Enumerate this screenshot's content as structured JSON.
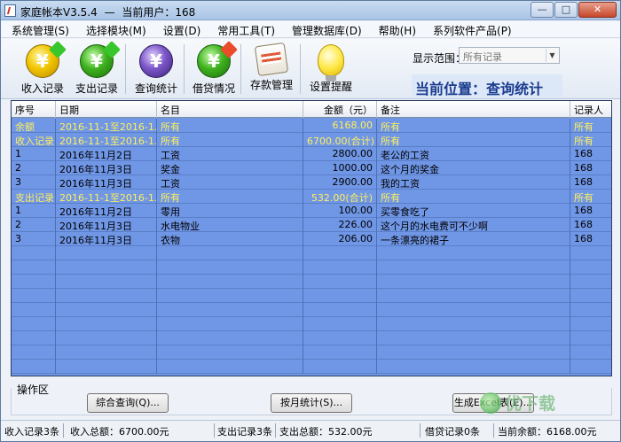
{
  "window": {
    "title": "家庭帐本V3.5.4",
    "separator": "—",
    "current_user": "当前用户：168",
    "minimize": "—",
    "maximize": "□",
    "close": "✕"
  },
  "menu": [
    "系统管理(S)",
    "选择模块(M)",
    "设置(D)",
    "常用工具(T)",
    "管理数据库(D)",
    "帮助(H)",
    "系列软件产品(P)"
  ],
  "toolbar": {
    "tools": [
      {
        "label": "收入记录",
        "icon": "income-coin-icon"
      },
      {
        "label": "支出记录",
        "icon": "expense-coin-icon"
      },
      {
        "label": "查询统计",
        "icon": "query-magnifier-icon"
      },
      {
        "label": "借贷情况",
        "icon": "loan-coin-icon"
      },
      {
        "label": "存款管理",
        "icon": "deposit-book-icon"
      },
      {
        "label": "设置提醒",
        "icon": "lightbulb-icon"
      }
    ],
    "range_label": "显示范围：",
    "range_value": "所有记录",
    "location": "当前位置：查询统计"
  },
  "table": {
    "columns": [
      "序号",
      "日期",
      "名目",
      "金额（元）",
      "备注",
      "记录人"
    ],
    "rows": [
      {
        "type": "summary",
        "cells": [
          "余额",
          "2016-11-1至2016-1...",
          "所有",
          "6168.00",
          "所有",
          "所有"
        ]
      },
      {
        "type": "summary",
        "cells": [
          "收入记录",
          "2016-11-1至2016-1...",
          "所有",
          "6700.00(合计)",
          "所有",
          "所有"
        ]
      },
      {
        "type": "detail",
        "cells": [
          "1",
          "2016年11月2日",
          "工资",
          "2800.00",
          "老公的工资",
          "168"
        ]
      },
      {
        "type": "detail",
        "cells": [
          "2",
          "2016年11月3日",
          "奖金",
          "1000.00",
          "这个月的奖金",
          "168"
        ]
      },
      {
        "type": "detail",
        "cells": [
          "3",
          "2016年11月3日",
          "工资",
          "2900.00",
          "我的工资",
          "168"
        ]
      },
      {
        "type": "summary",
        "cells": [
          "支出记录",
          "2016-11-1至2016-1...",
          "所有",
          "532.00(合计)",
          "所有",
          "所有"
        ]
      },
      {
        "type": "detail",
        "cells": [
          "1",
          "2016年11月2日",
          "零用",
          "100.00",
          "买零食吃了",
          "168"
        ]
      },
      {
        "type": "detail",
        "cells": [
          "2",
          "2016年11月3日",
          "水电物业",
          "226.00",
          "这个月的水电费可不少啊",
          "168"
        ]
      },
      {
        "type": "detail",
        "cells": [
          "3",
          "2016年11月3日",
          "衣物",
          "206.00",
          "一条漂亮的裙子",
          "168"
        ]
      }
    ]
  },
  "ops": {
    "label": "操作区",
    "buttons": [
      "综合查询(Q)...",
      "按月统计(S)...",
      "生成Excel表(E)..."
    ]
  },
  "status": [
    "收入记录3条",
    "收入总额：6700.00元",
    "支出记录3条",
    "支出总额：532.00元",
    "借贷记录0条",
    "当前余额：6168.00元"
  ],
  "watermark": "优下载"
}
